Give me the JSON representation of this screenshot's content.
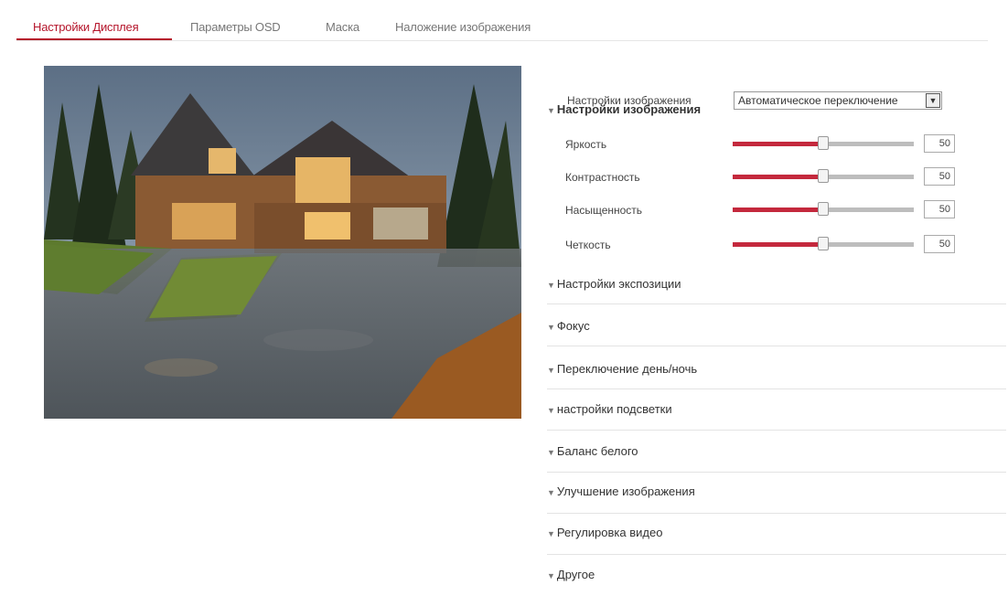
{
  "tabs": [
    {
      "label": "Настройки Дисплея",
      "active": true
    },
    {
      "label": "Параметры OSD",
      "active": false
    },
    {
      "label": "Маска",
      "active": false
    },
    {
      "label": "Наложение изображения",
      "active": false
    }
  ],
  "mode": {
    "label": "Настройки изображения",
    "value": "Автоматическое переключение"
  },
  "image_settings": {
    "title": "Настройки изображения",
    "sliders": [
      {
        "label": "Яркость",
        "value": "50",
        "level": 0.5
      },
      {
        "label": "Контрастность",
        "value": "50",
        "level": 0.5
      },
      {
        "label": "Насыщенность",
        "value": "50",
        "level": 0.5
      },
      {
        "label": "Четкость",
        "value": "50",
        "level": 0.5
      }
    ]
  },
  "sections": [
    "Настройки экспозиции",
    "Фокус",
    "Переключение день/ночь",
    "настройки подсветки",
    "Баланс белого",
    "Улучшение изображения",
    "Регулировка видео",
    "Другое"
  ],
  "colors": {
    "accent": "#b5152b",
    "slider_fill": "#c4293d",
    "slider_track": "#bdbdbd"
  }
}
